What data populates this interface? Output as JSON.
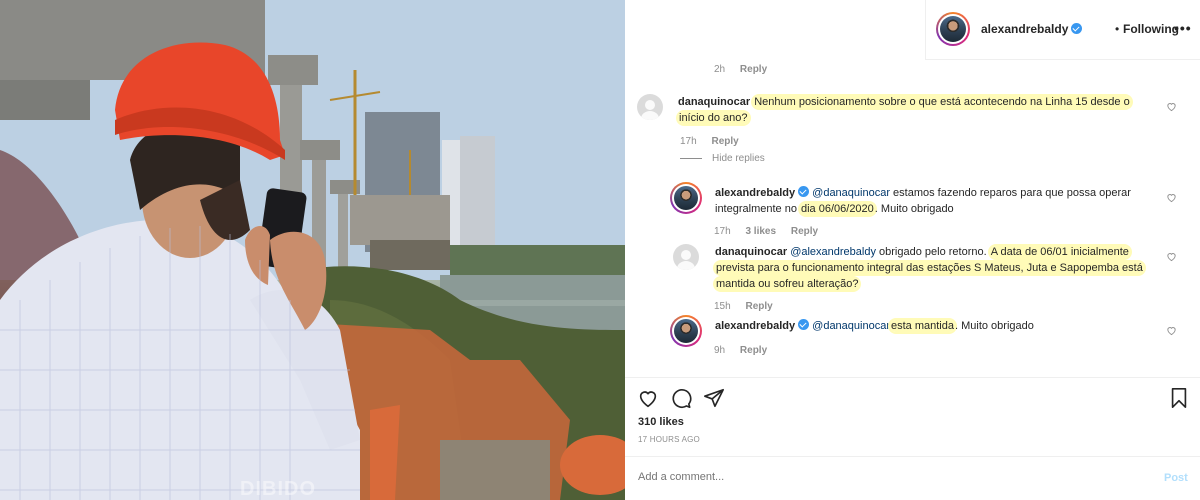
{
  "photo": {
    "watermark": "DIBIDO"
  },
  "header": {
    "username": "alexandrebaldy",
    "separator": "•",
    "follow_label": "Following",
    "more_label": "•••"
  },
  "top_meta": {
    "time": "2h",
    "reply": "Reply"
  },
  "comments": [
    {
      "username": "danaquinocar",
      "text": "Nenhum posicionamento sobre o que está acontecendo na Linha 15 desde o início do ano?",
      "line1": "Nenhum posicionamento sobre o que está acontecendo na Linha 15 desde o",
      "line2": "início do ano?",
      "time": "17h",
      "reply": "Reply",
      "hide_replies": "Hide replies"
    },
    {
      "username": "alexandrebaldy",
      "mention": "@danaquinocar",
      "text_a": " estamos fazendo reparos para que possa operar",
      "text_b": "integralmente no ",
      "highlight": "dia 06/06/2020",
      "text_c": ". Muito obrigado",
      "time": "17h",
      "likes": "3 likes",
      "reply": "Reply"
    },
    {
      "username": "danaquinocar",
      "mention": "@alexandrebaldy",
      "text_a": " obrigado pelo retorno. ",
      "hl1": "A data de 06/01 inicialmente",
      "hl2": "prevista para o funcionamento integral das estações S Mateus, Juta e Sapopemba está",
      "hl3": "mantida ou sofreu alteração?",
      "time": "15h",
      "reply": "Reply"
    },
    {
      "username": "alexandrebaldy",
      "mention": "@danaquinocar",
      "highlight": "esta mantida",
      "text_c": ". Muito obrigado",
      "time": "9h",
      "reply": "Reply"
    }
  ],
  "footer": {
    "likes": "310 likes",
    "time_ago": "17 HOURS AGO",
    "add_comment_placeholder": "Add a comment...",
    "post_label": "Post"
  },
  "colors": {
    "verified": "#3897f0",
    "highlight": "#fffbb8",
    "post_disabled": "#b2dffc"
  }
}
